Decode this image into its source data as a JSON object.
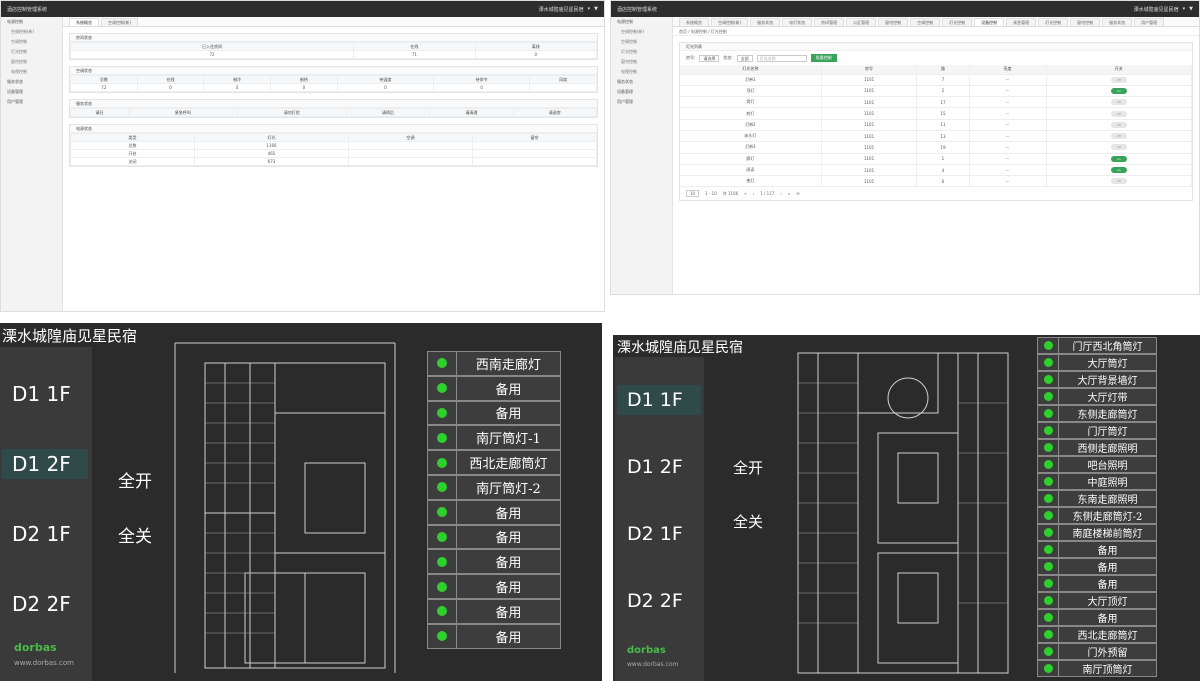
{
  "q1": {
    "app_title": "酒店控制管理系统",
    "user": "溧水城隍庙见星民宿",
    "sidebar": [
      {
        "label": "电源控制",
        "sub": false
      },
      {
        "label": "空调控制(新)",
        "sub": true
      },
      {
        "label": "空调控制",
        "sub": true
      },
      {
        "label": "灯光控制",
        "sub": true
      },
      {
        "label": "窗帘控制",
        "sub": true
      },
      {
        "label": "电视控制",
        "sub": true
      },
      {
        "label": "服务状态",
        "sub": false
      },
      {
        "label": "设备管理",
        "sub": false
      },
      {
        "label": "用户管理",
        "sub": false
      }
    ],
    "tabs": [
      "系统概览",
      "空调控制(新)"
    ],
    "room_panel": {
      "title": "房间状态",
      "headers": [
        "已入住房间",
        "在线",
        "离线"
      ],
      "values": [
        "72",
        "71",
        "0"
      ]
    },
    "ac_panel": {
      "title": "空调状态",
      "headers": [
        "总数",
        "在线",
        "制冷",
        "制热",
        "待温度",
        "待命令",
        "风扇"
      ],
      "values": [
        "72",
        "0",
        "0",
        "0",
        "0",
        "0",
        ""
      ]
    },
    "service_panel": {
      "title": "服务状态",
      "headers": [
        "请扫",
        "紧急呼叫",
        "请勿打扰",
        "请稍后",
        "请清理",
        "请退房"
      ]
    },
    "power_panel": {
      "title": "电源状态",
      "headers": [
        "类型",
        "灯光",
        "空调",
        "窗帘"
      ],
      "rows": [
        [
          "总数",
          "1166",
          "",
          ""
        ],
        [
          "开启",
          "465",
          "",
          ""
        ],
        [
          "关闭",
          "673",
          "",
          ""
        ]
      ]
    }
  },
  "q2": {
    "app_title": "酒店控制管理系统",
    "user": "溧水城隍庙见星民宿",
    "tabs": [
      "系统概览",
      "空调控制(新)",
      "服务状态",
      "电灯状态",
      "房间管理",
      "公区管理",
      "窗帘控制",
      "空调控制",
      "灯光控制",
      "设备控制",
      "紧急管理",
      "灯光控制",
      "窗帘控制",
      "服务状态",
      "用户管理"
    ],
    "sidebar": [
      {
        "label": "电源控制",
        "sub": false
      },
      {
        "label": "空调控制(新)",
        "sub": true
      },
      {
        "label": "空调控制",
        "sub": true
      },
      {
        "label": "灯光控制",
        "sub": true
      },
      {
        "label": "窗帘控制",
        "sub": true
      },
      {
        "label": "电视控制",
        "sub": true
      },
      {
        "label": "服务状态",
        "sub": false
      },
      {
        "label": "设备管理",
        "sub": false
      },
      {
        "label": "用户管理",
        "sub": false
      }
    ],
    "breadcrumb": [
      "首页",
      "电源控制",
      "灯光控制"
    ],
    "panel_title": "灯光列表",
    "filter": {
      "room_label": "房号:",
      "room_value": "请选择",
      "status_label": "状态:",
      "status_value": "全部",
      "search_placeholder": "灯光名称",
      "search_btn": "批量控制"
    },
    "headers": [
      "灯光名称",
      "房号",
      "路",
      "亮度",
      "开关"
    ],
    "rows": [
      [
        "灯带1",
        "1101",
        "7",
        "--",
        "off"
      ],
      [
        "顶灯",
        "1101",
        "2",
        "--",
        "on"
      ],
      [
        "筒灯",
        "1101",
        "17",
        "--",
        "off"
      ],
      [
        "射灯",
        "1101",
        "15",
        "--",
        "off"
      ],
      [
        "灯带2",
        "1101",
        "11",
        "--",
        "off"
      ],
      [
        "床头灯",
        "1101",
        "13",
        "--",
        "off"
      ],
      [
        "灯带3",
        "1101",
        "19",
        "--",
        "off"
      ],
      [
        "廊灯",
        "1101",
        "1",
        "--",
        "on"
      ],
      [
        "阅读",
        "1101",
        "4",
        "--",
        "on"
      ],
      [
        "夜灯",
        "1101",
        "6",
        "--",
        "off"
      ]
    ],
    "pager": {
      "size": "10",
      "range": "1 - 10",
      "total": "共 1166",
      "page": "1 / 117"
    }
  },
  "q3": {
    "title": "溧水城隍庙见星民宿",
    "floors": [
      {
        "label": "D1 1F",
        "active": false
      },
      {
        "label": "D1 2F",
        "active": true
      },
      {
        "label": "D2 1F",
        "active": false
      },
      {
        "label": "D2 2F",
        "active": false
      }
    ],
    "all_on": "全开",
    "all_off": "全关",
    "lights": [
      "西南走廊灯",
      "备用",
      "备用",
      "南厅筒灯-1",
      "西北走廊筒灯",
      "南厅筒灯-2",
      "备用",
      "备用",
      "备用",
      "备用",
      "备用",
      "备用"
    ],
    "logo": "dorbas",
    "site": "www.dorbas.com"
  },
  "q4": {
    "title": "溧水城隍庙见星民宿",
    "floors": [
      {
        "label": "D1 1F",
        "active": true
      },
      {
        "label": "D1 2F",
        "active": false
      },
      {
        "label": "D2 1F",
        "active": false
      },
      {
        "label": "D2 2F",
        "active": false
      }
    ],
    "all_on": "全开",
    "all_off": "全关",
    "lights": [
      "门厅西北角筒灯",
      "大厅筒灯",
      "大厅背景墙灯",
      "大厅灯带",
      "东侧走廊筒灯",
      "门厅筒灯",
      "西侧走廊照明",
      "吧台照明",
      "中庭照明",
      "东南走廊照明",
      "东侧走廊筒灯-2",
      "南庭楼梯前筒灯",
      "备用",
      "备用",
      "备用",
      "大厅顶灯",
      "备用",
      "西北走廊筒灯",
      "门外预留",
      "南厅顶筒灯"
    ],
    "logo": "dorbas",
    "site": "www.dorbas.com"
  }
}
